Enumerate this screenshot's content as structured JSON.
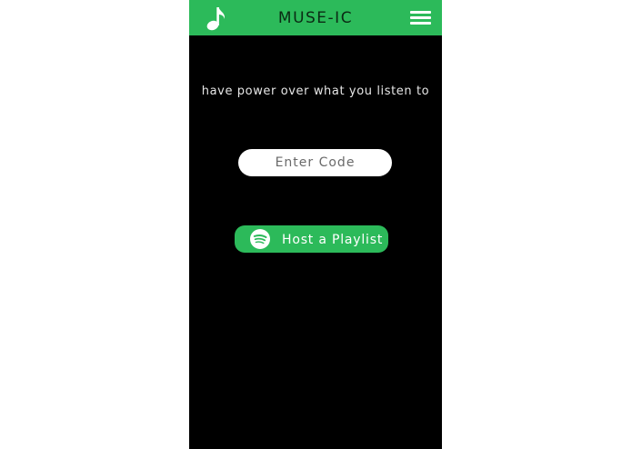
{
  "header": {
    "title": "MUSE-IC",
    "logo_icon": "music-note-icon",
    "menu_icon": "hamburger-menu-icon"
  },
  "main": {
    "tagline": "have power over what you listen to",
    "code_input": {
      "placeholder": "Enter Code",
      "value": ""
    },
    "host_button": {
      "label": "Host a Playlist",
      "icon": "spotify-icon"
    }
  },
  "colors": {
    "brand_green": "#2cba5a",
    "background": "#000000",
    "text_light": "#e6e6e6"
  }
}
